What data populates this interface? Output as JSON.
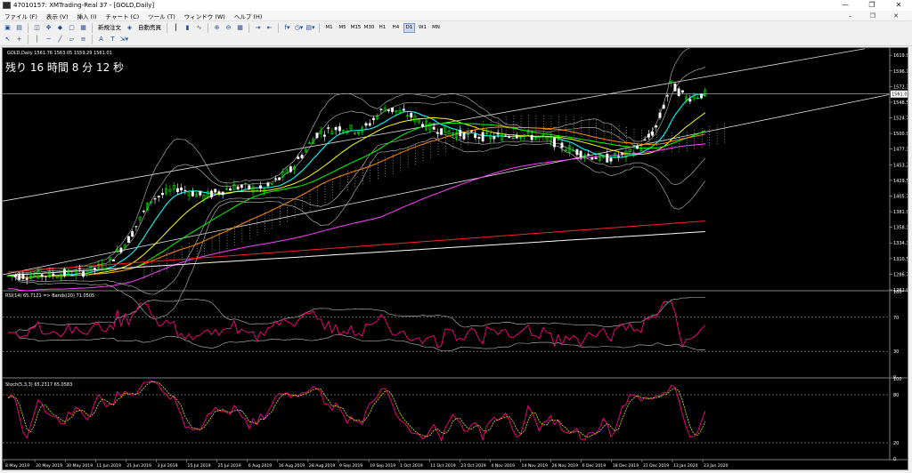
{
  "window": {
    "title": "47010157: XMTrading-Real 37 - [GOLD,Daily]",
    "controls": [
      "—",
      "❐",
      "✕"
    ]
  },
  "menu": {
    "items": [
      "ファイル (F)",
      "表示 (V)",
      "挿入 (I)",
      "チャート (C)",
      "ツール (T)",
      "ウィンドウ (W)",
      "ヘルプ (H)"
    ],
    "mdi_controls": "– ❐ ✕"
  },
  "toolbar": {
    "new_order": "新規注文",
    "auto_trading": "自動売買",
    "timeframes": [
      "M1",
      "M5",
      "M15",
      "M30",
      "H1",
      "H4",
      "D1",
      "W1",
      "MN"
    ],
    "active_timeframe": "D1"
  },
  "chart": {
    "symbol_line": "GOLD,Daily  1561.76 1563.05 1559.29 1561.01",
    "countdown": "残り 16 時間 8 分 12 秒",
    "current_price": "1561.01",
    "price_axis": [
      "1619.90",
      "1596.10",
      "1572.30",
      "1548.50",
      "1524.70",
      "1500.90",
      "1477.10",
      "1453.25",
      "1429.50",
      "1405.70",
      "1381.90",
      "1358.10",
      "1334.30",
      "1310.50",
      "1286.70",
      "1262.90"
    ],
    "date_axis": [
      "8 May 2019",
      "20 May 2019",
      "30 May 2019",
      "11 Jun 2019",
      "21 Jun 2019",
      "3 Jul 2019",
      "15 Jul 2019",
      "25 Jul 2019",
      "6 Aug 2019",
      "16 Aug 2019",
      "28 Aug 2019",
      "9 Sep 2019",
      "19 Sep 2019",
      "1 Oct 2019",
      "11 Oct 2019",
      "23 Oct 2019",
      "4 Nov 2019",
      "14 Nov 2019",
      "26 Nov 2019",
      "6 Dec 2019",
      "18 Dec 2019",
      "31 Dec 2019",
      "13 Jan 2020",
      "23 Jan 2020"
    ],
    "colors": {
      "background": "#000000",
      "bull_candle": "#00ff00",
      "bear_candle": "#ffffff",
      "bands": "#c0c0c0",
      "rsi": "#ff0080",
      "stoch_main": "#ff0080",
      "stoch_signal": "#ffff00"
    }
  },
  "rsi_panel": {
    "label": "RSI(14) 65.7121  => Bands(20) 71.0505",
    "levels": [
      "100",
      "70",
      "30",
      "0"
    ]
  },
  "stoch_panel": {
    "label": "Stoch(5,3,3) 65.2317 65.0583",
    "levels": [
      "100",
      "80",
      "20",
      "0"
    ]
  }
}
